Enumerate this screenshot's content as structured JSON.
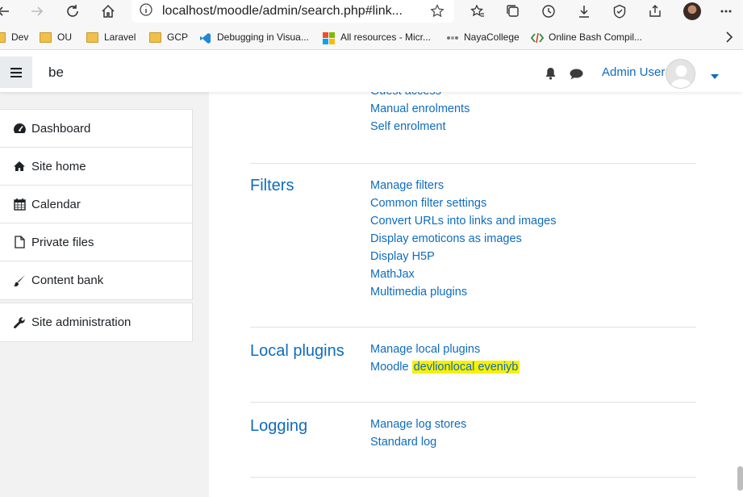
{
  "browser": {
    "url": "localhost/moodle/admin/search.php#link...",
    "bookmarks": [
      "Dev",
      "OU",
      "Laravel",
      "GCP",
      "Debugging in Visua...",
      "All resources - Micr...",
      "NayaCollege",
      "Online Bash Compil..."
    ]
  },
  "navbar": {
    "site_name": "be",
    "user_name": "Admin User"
  },
  "sidebar": {
    "items": [
      {
        "label": "Dashboard",
        "icon": "dashboard-icon"
      },
      {
        "label": "Site home",
        "icon": "home-icon"
      },
      {
        "label": "Calendar",
        "icon": "calendar-icon"
      },
      {
        "label": "Private files",
        "icon": "file-icon"
      },
      {
        "label": "Content bank",
        "icon": "paintbrush-icon"
      }
    ],
    "admin_item": {
      "label": "Site administration",
      "icon": "wrench-icon"
    }
  },
  "sections": {
    "enrolments": {
      "links": [
        "Guest access",
        "Manual enrolments",
        "Self enrolment"
      ]
    },
    "filters": {
      "title": "Filters",
      "links": [
        "Manage filters",
        "Common filter settings",
        "Convert URLs into links and images",
        "Display emoticons as images",
        "Display H5P",
        "MathJax",
        "Multimedia plugins"
      ]
    },
    "local_plugins": {
      "title": "Local plugins",
      "links": [
        "Manage local plugins"
      ],
      "moodle_prefix": "Moodle",
      "highlighted": "devlionlocal eveniyb"
    },
    "logging": {
      "title": "Logging",
      "links": [
        "Manage log stores",
        "Standard log"
      ]
    }
  },
  "colors": {
    "link": "#0f6cbf",
    "highlight": "#f8f000"
  }
}
